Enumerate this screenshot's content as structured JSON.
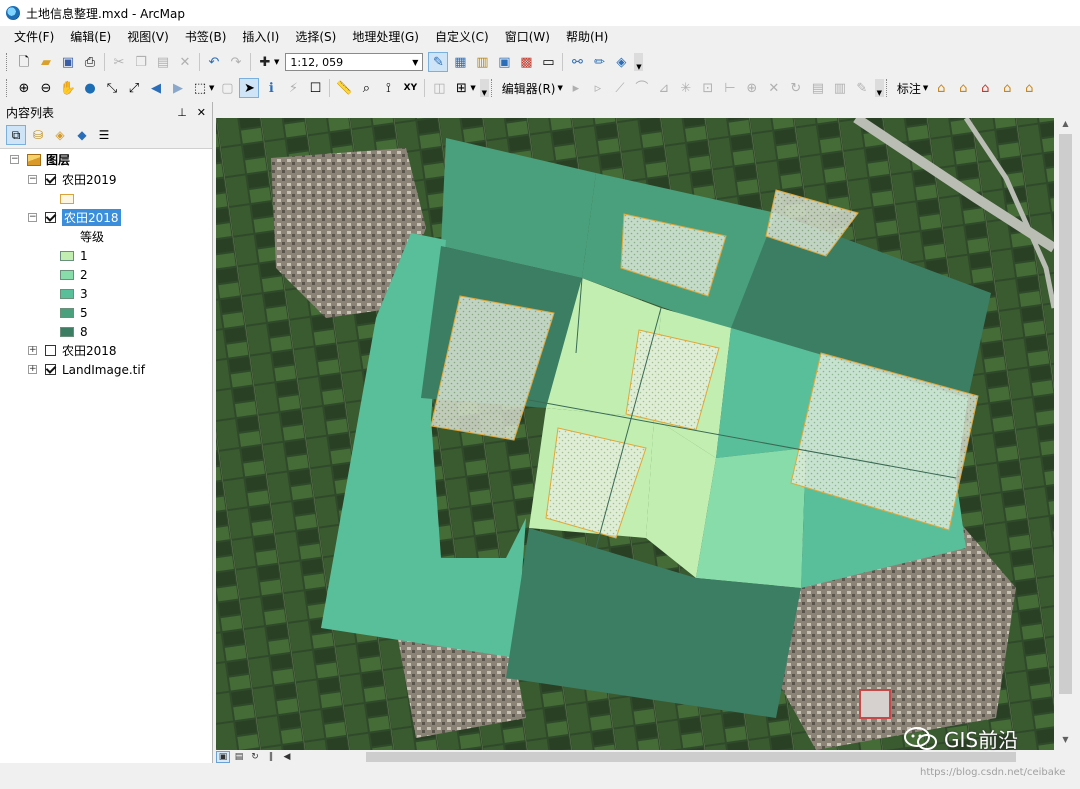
{
  "window": {
    "title": "土地信息整理.mxd - ArcMap"
  },
  "menu": [
    "文件(F)",
    "编辑(E)",
    "视图(V)",
    "书签(B)",
    "插入(I)",
    "选择(S)",
    "地理处理(G)",
    "自定义(C)",
    "窗口(W)",
    "帮助(H)"
  ],
  "toolbar": {
    "scale_value": "1:12, 059",
    "editor_label": "编辑器(R)",
    "labeling_label": "标注"
  },
  "toc": {
    "title": "内容列表",
    "pin": "ᵖ",
    "close": "✕",
    "root": "图层",
    "layers": [
      {
        "name": "农田2019",
        "checked": true,
        "expanded": true
      },
      {
        "name": "农田2018",
        "checked": true,
        "expanded": true,
        "selected": true,
        "legend_field": "等级",
        "legend": [
          {
            "label": "1",
            "color": "#c2efb1"
          },
          {
            "label": "2",
            "color": "#87dcaa"
          },
          {
            "label": "3",
            "color": "#58bf9a"
          },
          {
            "label": "5",
            "color": "#4a9f7c"
          },
          {
            "label": "8",
            "color": "#3c7e63"
          }
        ]
      },
      {
        "name": "农田2018",
        "checked": false,
        "expanded": false
      },
      {
        "name": "LandImage.tif",
        "checked": true,
        "expanded": false
      }
    ]
  },
  "watermark": {
    "text": "GIS前沿"
  },
  "footer": {
    "url": "https://blog.csdn.net/ceibake"
  }
}
